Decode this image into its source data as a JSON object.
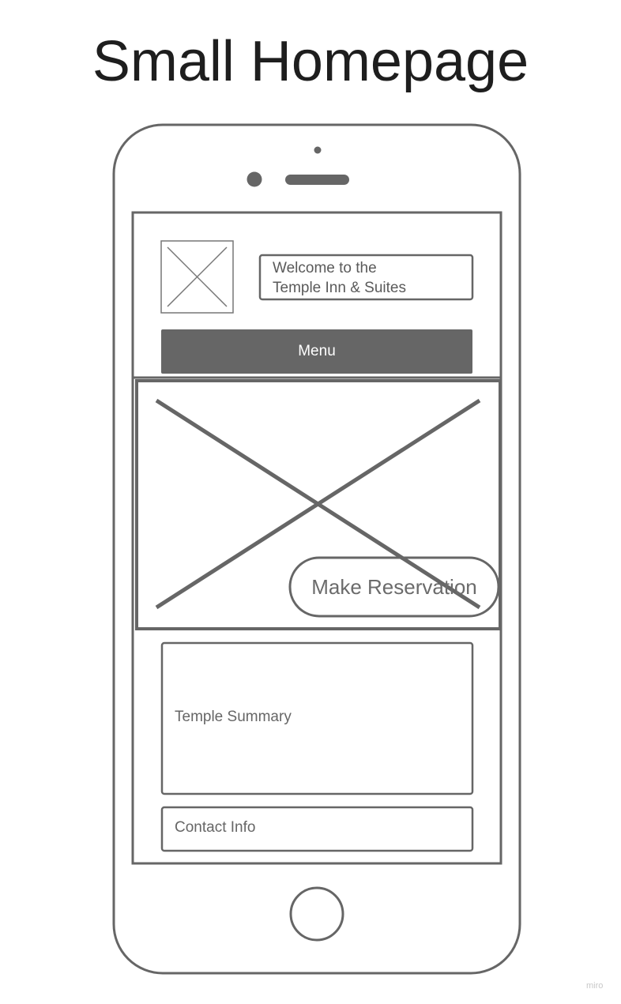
{
  "page": {
    "title": "Small Homepage"
  },
  "header": {
    "logo_placeholder": "image-placeholder",
    "welcome_text": "Welcome to the\nTemple Inn & Suites"
  },
  "nav": {
    "menu_label": "Menu"
  },
  "hero": {
    "image_placeholder": "image-placeholder",
    "reservation_label": "Make Reservation"
  },
  "content": {
    "summary_label": "Temple Summary",
    "contact_label": "Contact Info"
  },
  "watermark": "miro",
  "colors": {
    "stroke": "#666666",
    "menu_fill": "#666666",
    "title": "#1e1e1e"
  }
}
